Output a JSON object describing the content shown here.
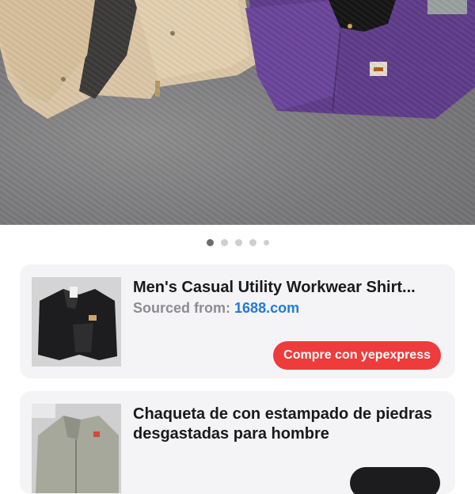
{
  "hero": {
    "image_alt": "",
    "carousel": {
      "total": 5,
      "active": 0
    }
  },
  "products": [
    {
      "title": "Men's Casual Utility Workwear Shirt...",
      "source_label": "Sourced from:",
      "source_site": "1688.com",
      "button_label": "Compre con yepexpress"
    },
    {
      "title": "Chaqueta de con estampado de piedras desgastadas para hombre"
    }
  ],
  "colors": {
    "accent_red": "#ee3b3b",
    "link_blue": "#1f7ae0",
    "card_bg": "#f4f4f6"
  }
}
